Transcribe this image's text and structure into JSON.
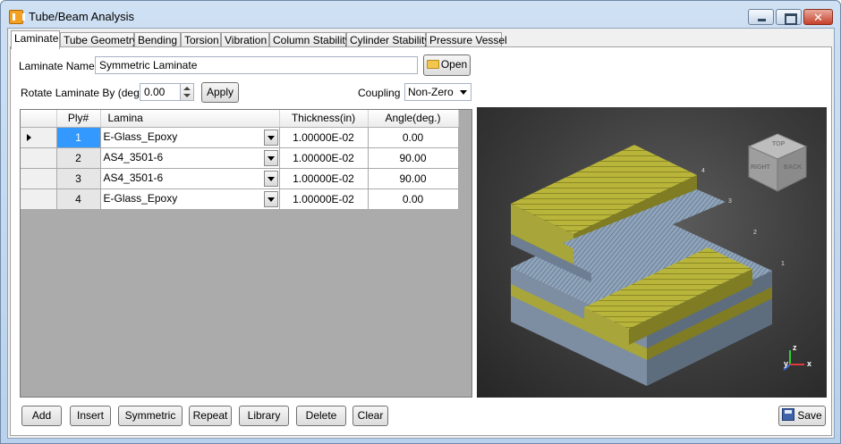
{
  "window": {
    "title": "Tube/Beam Analysis"
  },
  "tabs": [
    "Laminate",
    "Tube Geometry",
    "Bending",
    "Torsion",
    "Vibration",
    "Column Stability",
    "Cylinder Stability",
    "Pressure Vessel"
  ],
  "form": {
    "laminate_name_label": "Laminate Name:",
    "laminate_name_value": "Symmetric Laminate",
    "open_label": "Open",
    "rotate_label": "Rotate Laminate By (deg.)",
    "rotate_value": "0.00",
    "apply_label": "Apply",
    "coupling_label": "Coupling",
    "coupling_value": "Non-Zero"
  },
  "grid": {
    "columns": [
      "Ply#",
      "Lamina",
      "Thickness(in)",
      "Angle(deg.)"
    ],
    "rows": [
      {
        "ply": "1",
        "lamina": "E-Glass_Epoxy",
        "thickness": "1.00000E-02",
        "angle": "0.00"
      },
      {
        "ply": "2",
        "lamina": "AS4_3501-6",
        "thickness": "1.00000E-02",
        "angle": "90.00"
      },
      {
        "ply": "3",
        "lamina": "AS4_3501-6",
        "thickness": "1.00000E-02",
        "angle": "90.00"
      },
      {
        "ply": "4",
        "lamina": "E-Glass_Epoxy",
        "thickness": "1.00000E-02",
        "angle": "0.00"
      }
    ]
  },
  "viewport": {
    "ply_tags": [
      "1",
      "2",
      "3",
      "4"
    ],
    "cube_faces": {
      "top": "TOP",
      "right": "RIGHT",
      "back": "BACK"
    },
    "axes": {
      "x": "x",
      "y": "y",
      "z": "z"
    },
    "colors": {
      "glass": "#b8b53a",
      "carbon": "#8fa4bb",
      "background": "#3c3c3c"
    }
  },
  "actions": {
    "add": "Add",
    "insert": "Insert",
    "symmetric": "Symmetric",
    "repeat": "Repeat",
    "library": "Library",
    "delete": "Delete",
    "clear": "Clear",
    "save": "Save"
  }
}
